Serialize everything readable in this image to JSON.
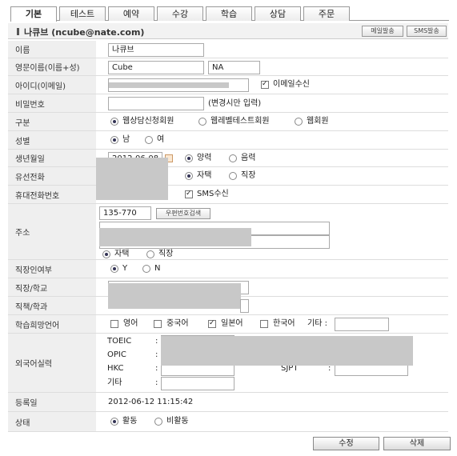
{
  "tabs": [
    "기본",
    "테스트",
    "예약",
    "수강",
    "학습",
    "상담",
    "주문"
  ],
  "header": {
    "title": "나큐브 (ncube@nate.com)",
    "mail_btn": "메일발송",
    "sms_btn": "SMS발송"
  },
  "labels": {
    "name": "이름",
    "eng_name": "영문이름(이름+성)",
    "user_id": "아이디(이메일)",
    "password": "비밀번호",
    "type": "구분",
    "gender": "성별",
    "birth": "생년월일",
    "phone": "유선전화",
    "mobile": "휴대전화번호",
    "address": "주소",
    "employed": "직장인여부",
    "company": "직장/학교",
    "position": "직책/학과",
    "language": "학습희망언어",
    "foreign": "외국어실력",
    "reg_date": "등록일",
    "status": "상태"
  },
  "values": {
    "name": "나큐브",
    "first_name": "Cube",
    "last_name": "NA",
    "email_receive": "이메일수신",
    "password_hint": "(변경시만 입력)",
    "type_options": [
      "웹상담신청회원",
      "웹레벨테스트회원",
      "웹회원"
    ],
    "gender_options": [
      "남",
      "여"
    ],
    "birth_date": "2012-06-08",
    "calendar_options": [
      "양력",
      "음력"
    ],
    "phone_options": [
      "자택",
      "직장"
    ],
    "sms_receive": "SMS수신",
    "zipcode": "135-770",
    "zip_search": "우편번호검색",
    "address_options": [
      "자택",
      "직장"
    ],
    "employed_options": [
      "Y",
      "N"
    ],
    "languages": [
      "영어",
      "중국어",
      "일본어",
      "한국어"
    ],
    "lang_etc": "기타 :",
    "tests": [
      "TOEIC",
      "OPIC",
      "HKC",
      "기타"
    ],
    "jpt_label": "SJPT",
    "reg_date": "2012-06-12 11:15:42",
    "status_options": [
      "활동",
      "비활동"
    ]
  },
  "buttons": {
    "edit": "수정",
    "delete": "삭제"
  }
}
